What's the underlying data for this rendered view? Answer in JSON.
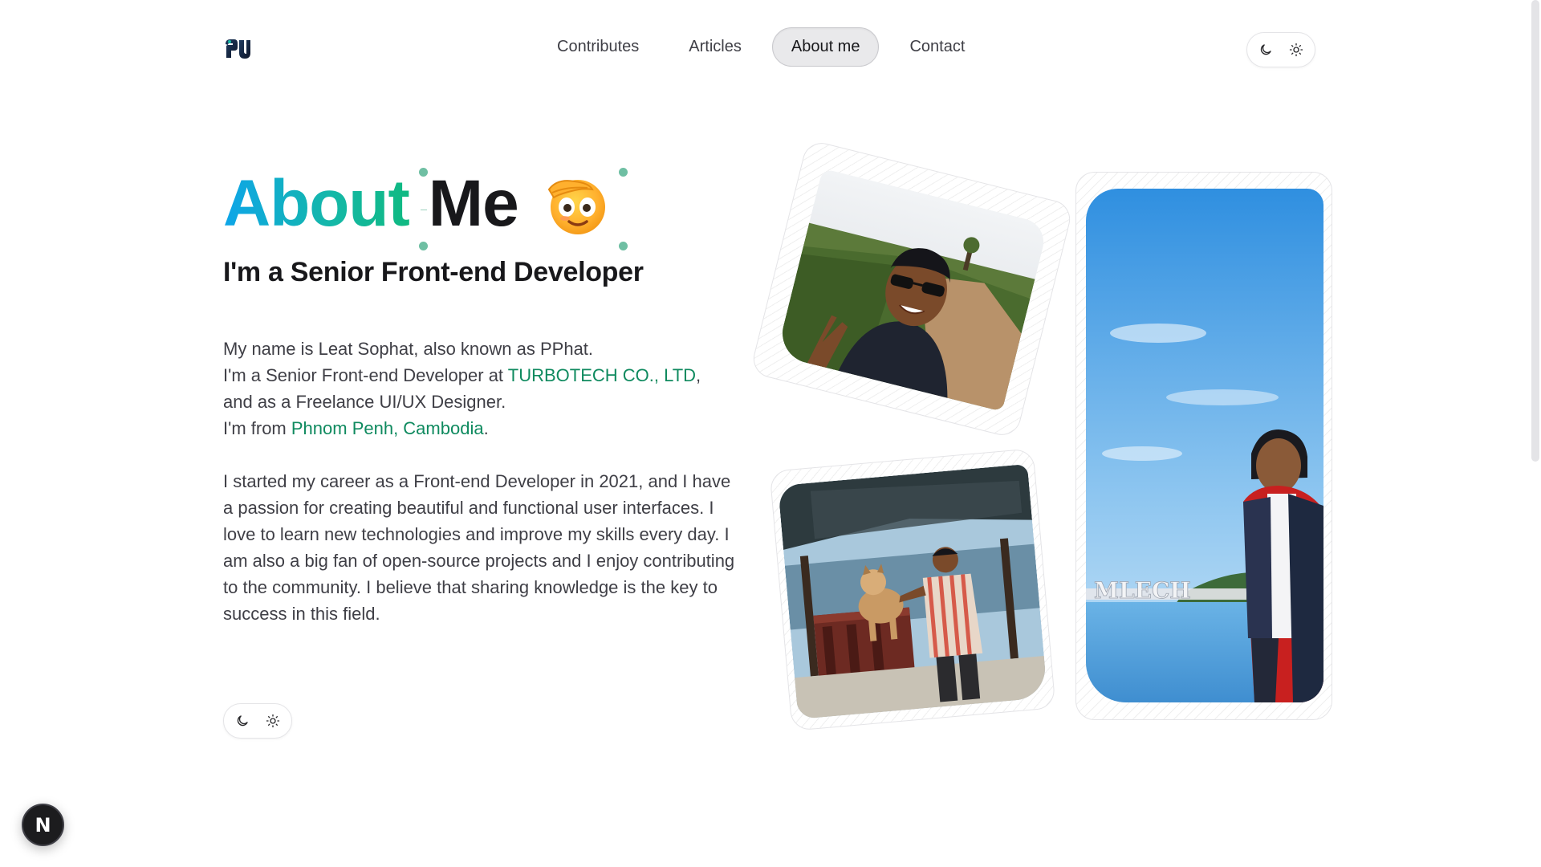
{
  "header": {
    "logo_icon": "pp-monogram-logo",
    "nav": [
      {
        "label": "Contributes",
        "active": false
      },
      {
        "label": "Articles",
        "active": false
      },
      {
        "label": "About me",
        "active": true
      },
      {
        "label": "Contact",
        "active": false
      }
    ],
    "theme_toggle": {
      "dark_icon": "moon-icon",
      "light_icon": "sun-icon"
    }
  },
  "hero": {
    "title_part1": "About",
    "title_part2": "Me",
    "emoji_icon": "saluting-face-emoji",
    "subtitle": "I'm a Senior Front-end Developer"
  },
  "intro": {
    "line1": "My name is Leat Sophat, also known as PPhat.",
    "line2_prefix": "I'm a Senior Front-end Developer at ",
    "company": "TURBOTECH CO., LTD",
    "line2_suffix": ",",
    "line3": "and as a Freelance UI/UX Designer.",
    "line4_prefix": "I'm from ",
    "location": "Phnom Penh, Cambodia",
    "line4_suffix": "."
  },
  "career": {
    "text": "I started my career as a Front-end Developer in 2021, and I have a passion for creating beautiful and functional user interfaces. I love to learn new technologies and improve my skills every day. I am also a big fan of open-source projects and I enjoy contributing to the community. I believe that sharing knowledge is the key to success in this field."
  },
  "photos": [
    {
      "name": "selfie-photo"
    },
    {
      "name": "dog-photo"
    },
    {
      "name": "lake-photo",
      "sign_text": "MLECH"
    }
  ],
  "footer": {
    "badge_label": "N"
  },
  "colors": {
    "accent_link": "#0f8a5f",
    "gradient_start": "#0ea5e9",
    "gradient_end": "#10b981",
    "active_nav_bg": "#e9e9eb"
  }
}
